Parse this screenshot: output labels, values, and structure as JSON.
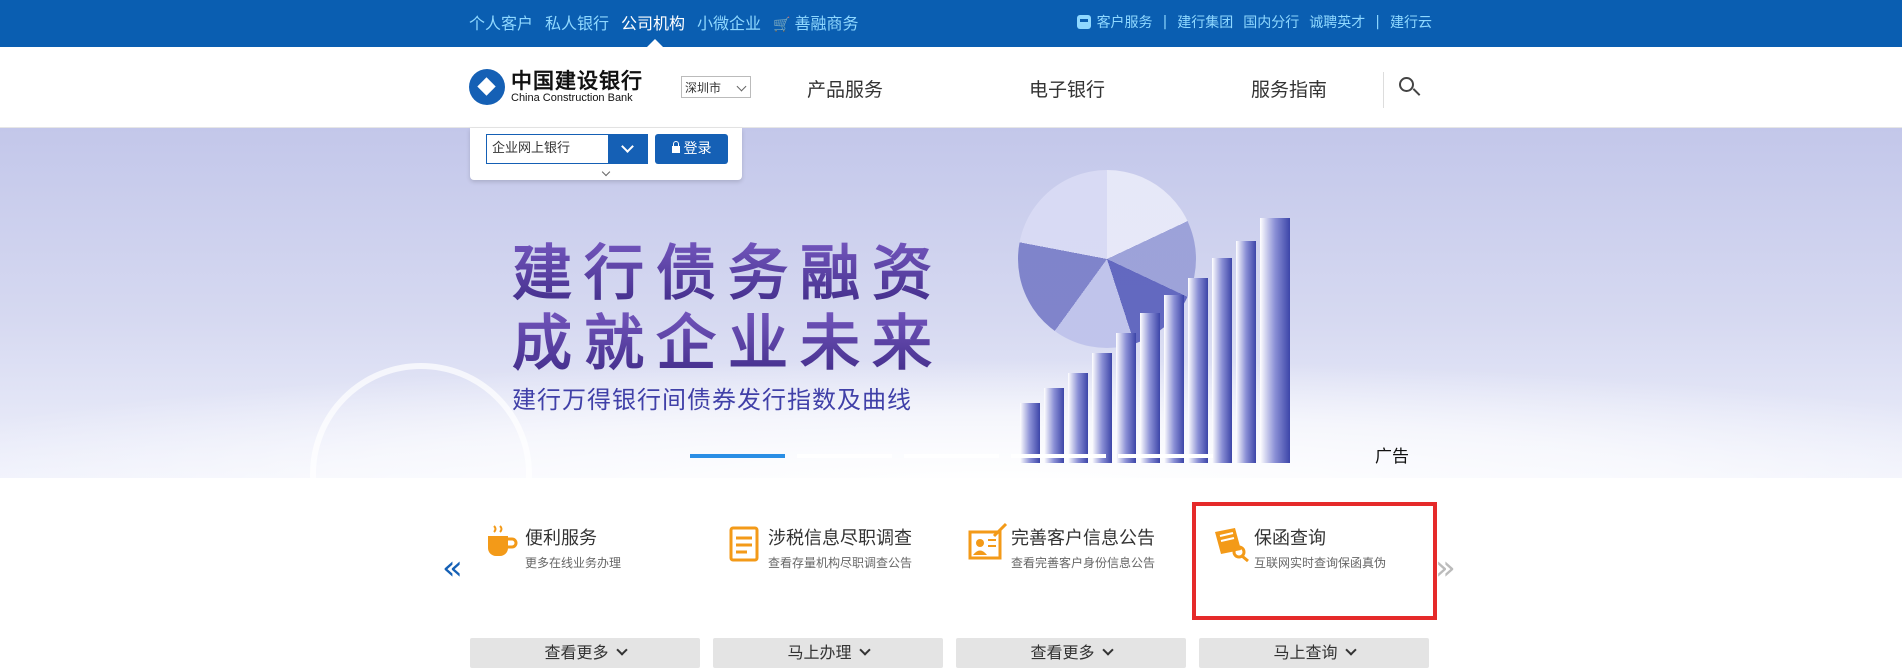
{
  "topbar": {
    "left_links": [
      "个人客户",
      "私人银行",
      "公司机构",
      "小微企业",
      "善融商务"
    ],
    "active_link": "公司机构",
    "right_links": [
      "客户服务",
      "建行集团",
      "国内分行",
      "诚聘英才",
      "建行云"
    ]
  },
  "header": {
    "logo_cn": "中国建设银行",
    "logo_en": "China Construction Bank",
    "city": "深圳市",
    "nav": [
      "产品服务",
      "电子银行",
      "服务指南"
    ]
  },
  "login": {
    "select_value": "企业网上银行",
    "button_label": "登录"
  },
  "banner": {
    "title_line1": "建行债务融资",
    "title_line2": "成就企业未来",
    "subtitle": "建行万得银行间债券发行指数及曲线",
    "ad_label": "广告",
    "active_slide": 1,
    "slide_count": 5
  },
  "services": [
    {
      "title": "便利服务",
      "desc": "更多在线业务办理",
      "button": "查看更多"
    },
    {
      "title": "涉税信息尽职调查",
      "desc": "查看存量机构尽职调查公告",
      "button": "马上办理"
    },
    {
      "title": "完善客户信息公告",
      "desc": "查看完善客户身份信息公告",
      "button": "查看更多"
    },
    {
      "title": "保函查询",
      "desc": "互联网实时查询保函真伪",
      "button": "马上查询"
    }
  ],
  "carousel_arrows": {
    "prev": "«",
    "next": "»"
  },
  "colors": {
    "brand_blue": "#0a5eb1",
    "highlight_red": "#e52a2a",
    "icon_orange": "#f39a18"
  }
}
